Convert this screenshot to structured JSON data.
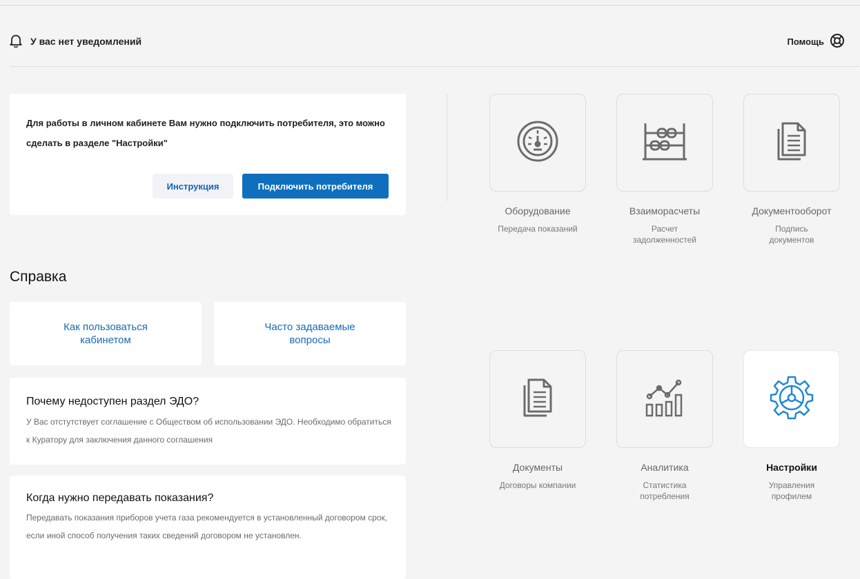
{
  "header": {
    "notifications_text": "У вас нет уведомлений",
    "help_label": "Помощь"
  },
  "notice": {
    "text": "Для работы в личном кабинете Вам нужно подключить потребителя, это можно сделать в разделе \"Настройки\"",
    "instruction_button": "Инструкция",
    "connect_button": "Подключить потребителя"
  },
  "help_section": {
    "title": "Справка",
    "links": [
      {
        "label": "Как пользоваться кабинетом"
      },
      {
        "label": "Часто задаваемые вопросы"
      }
    ],
    "faq": [
      {
        "question": "Почему недоступен раздел ЭДО?",
        "answer": "У Вас отстутствует соглашение с Обществом об использовании ЭДО. Необходимо обратиться к Куратору для заключения данного соглашения"
      },
      {
        "question": "Когда нужно передавать показания?",
        "answer": "Передавать показания приборов учета газа рекомендуется в установленный договором срок, если иной способ получения таких сведений договором не установлен."
      }
    ]
  },
  "tiles": [
    {
      "title": "Оборудование",
      "subtitle": "Передача показаний",
      "icon": "gauge-icon",
      "active": false
    },
    {
      "title": "Взаиморасчеты",
      "subtitle": "Расчет задолженностей",
      "icon": "abacus-icon",
      "active": false
    },
    {
      "title": "Документооборот",
      "subtitle": "Подпись документов",
      "icon": "documents-icon",
      "active": false
    },
    {
      "title": "Документы",
      "subtitle": "Договоры компании",
      "icon": "documents-icon",
      "active": false
    },
    {
      "title": "Аналитика",
      "subtitle": "Статистика потребления",
      "icon": "analytics-icon",
      "active": false
    },
    {
      "title": "Настройки",
      "subtitle": "Управления профилем",
      "icon": "gear-icon",
      "active": true
    }
  ],
  "colors": {
    "accent": "#0f6fbd",
    "link": "#1a6bb5",
    "active_icon": "#1e88d6",
    "inactive_icon": "#6b6b6b"
  }
}
